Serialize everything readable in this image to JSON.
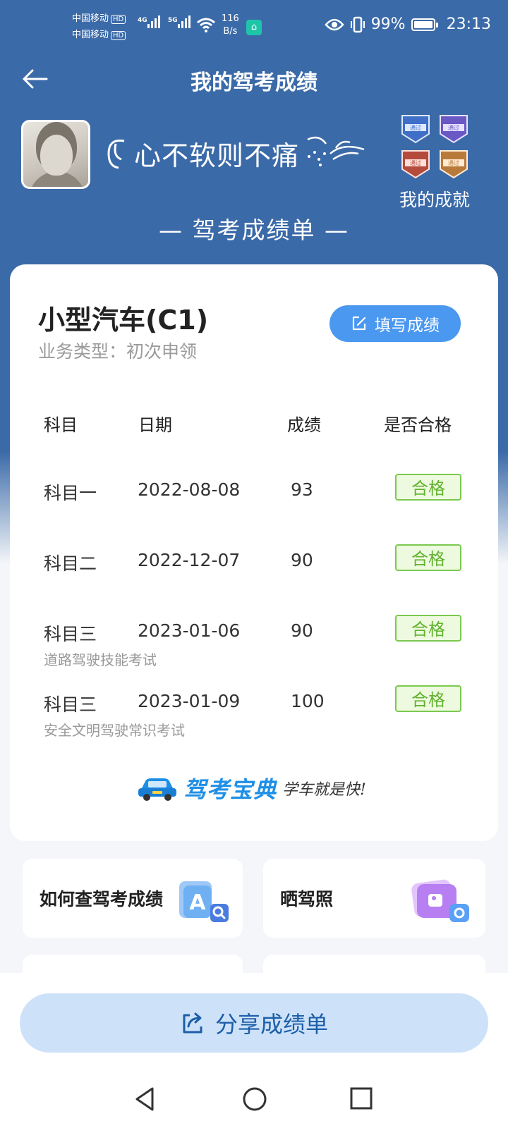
{
  "status_bar": {
    "carrier1": "中国移动",
    "carrier2": "中国移动",
    "hd": "HD",
    "net1": "4G",
    "net2": "5G",
    "speed_value": "116",
    "speed_unit": "B/s",
    "battery": "99%",
    "time": "23:13"
  },
  "header": {
    "title": "我的驾考成绩"
  },
  "profile": {
    "nickname": "心不软则不痛",
    "achievements_label": "我的成就",
    "badge_texts": [
      "通过",
      "通过",
      "通过",
      "通过"
    ],
    "subtitle": "— 驾考成绩单 —"
  },
  "card": {
    "license_title": "小型汽车(C1)",
    "business_type": "业务类型：初次申领",
    "fill_button": "填写成绩",
    "columns": [
      "科目",
      "日期",
      "成绩",
      "是否合格"
    ],
    "rows": [
      {
        "subject": "科目一",
        "date": "2022-08-08",
        "score": "93",
        "result": "合格",
        "note": ""
      },
      {
        "subject": "科目二",
        "date": "2022-12-07",
        "score": "90",
        "result": "合格",
        "note": ""
      },
      {
        "subject": "科目三",
        "date": "2023-01-06",
        "score": "90",
        "result": "合格",
        "note": "道路驾驶技能考试"
      },
      {
        "subject": "科目三",
        "date": "2023-01-09",
        "score": "100",
        "result": "合格",
        "note": "安全文明驾驶常识考试"
      }
    ],
    "brand_name": "驾考宝典",
    "brand_slogan": "学车就是快!"
  },
  "tiles": [
    {
      "label": "如何查驾考成绩",
      "icon": "search-document-icon"
    },
    {
      "label": "晒驾照",
      "icon": "photo-camera-icon"
    }
  ],
  "share_button": "分享成绩单",
  "colors": {
    "header_blue": "#3b6aa8",
    "primary_blue": "#4a98f0",
    "pass_green": "#62b32f",
    "share_bg": "#cde2f9"
  }
}
